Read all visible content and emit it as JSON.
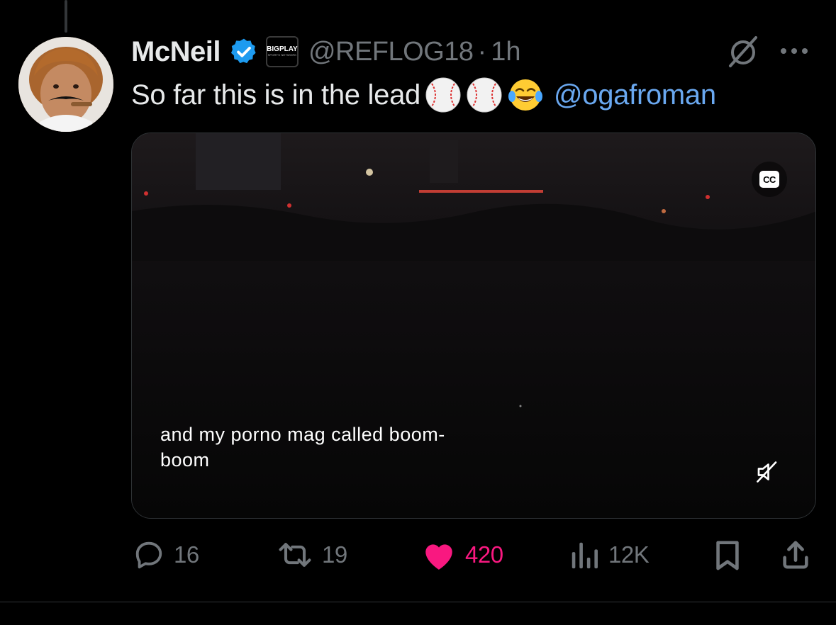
{
  "tweet": {
    "author_name": "McNeil",
    "verified_icon": "verified-badge-icon",
    "affiliate_badge": {
      "line1": "BIGPLAY",
      "line2": "SPORTS NETWORK"
    },
    "handle": "@REFLOG18",
    "separator": "·",
    "time": "1h",
    "text": "So far this is in the lead",
    "emojis": [
      "baseball-emoji",
      "baseball-emoji",
      "tears-of-joy-emoji"
    ],
    "mention": "@ogafroman"
  },
  "media": {
    "type": "video",
    "cc_label": "CC",
    "caption_line1": "and my porno mag called boom-",
    "caption_line2": "boom",
    "mute_icon": "muted-speaker-icon"
  },
  "actions": {
    "replies": "16",
    "reposts": "19",
    "likes": "420",
    "views": "12K",
    "bookmark_icon": "bookmark-icon",
    "share_icon": "share-icon"
  },
  "colors": {
    "background": "#000000",
    "text": "#e7e9ea",
    "secondary": "#71767b",
    "link": "#6aa8f0",
    "like": "#f91880",
    "verified": "#1d9bf0"
  }
}
